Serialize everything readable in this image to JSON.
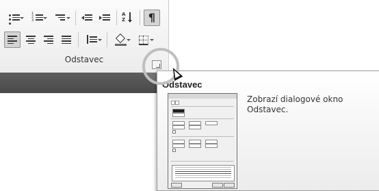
{
  "ribbon": {
    "group_label": "Odstavec"
  },
  "tooltip": {
    "title": "Odstavec",
    "description": "Zobrazí dialogové okno Odstavec."
  },
  "colors": {
    "ribbon_bg": "#f3f3f3",
    "dark_bar": "#545454",
    "tooltip_border": "#9a9a9a",
    "highlight_circle": "#bfbfbf"
  },
  "icons": {
    "row1": [
      "bullets-icon",
      "numbering-icon",
      "multilevel-list-icon",
      "decrease-indent-icon",
      "increase-indent-icon",
      "sort-icon",
      "show-formatting-marks-icon"
    ],
    "row2": [
      "align-left-icon",
      "center-icon",
      "align-right-icon",
      "justify-icon",
      "line-spacing-icon",
      "shading-icon",
      "borders-icon"
    ]
  }
}
